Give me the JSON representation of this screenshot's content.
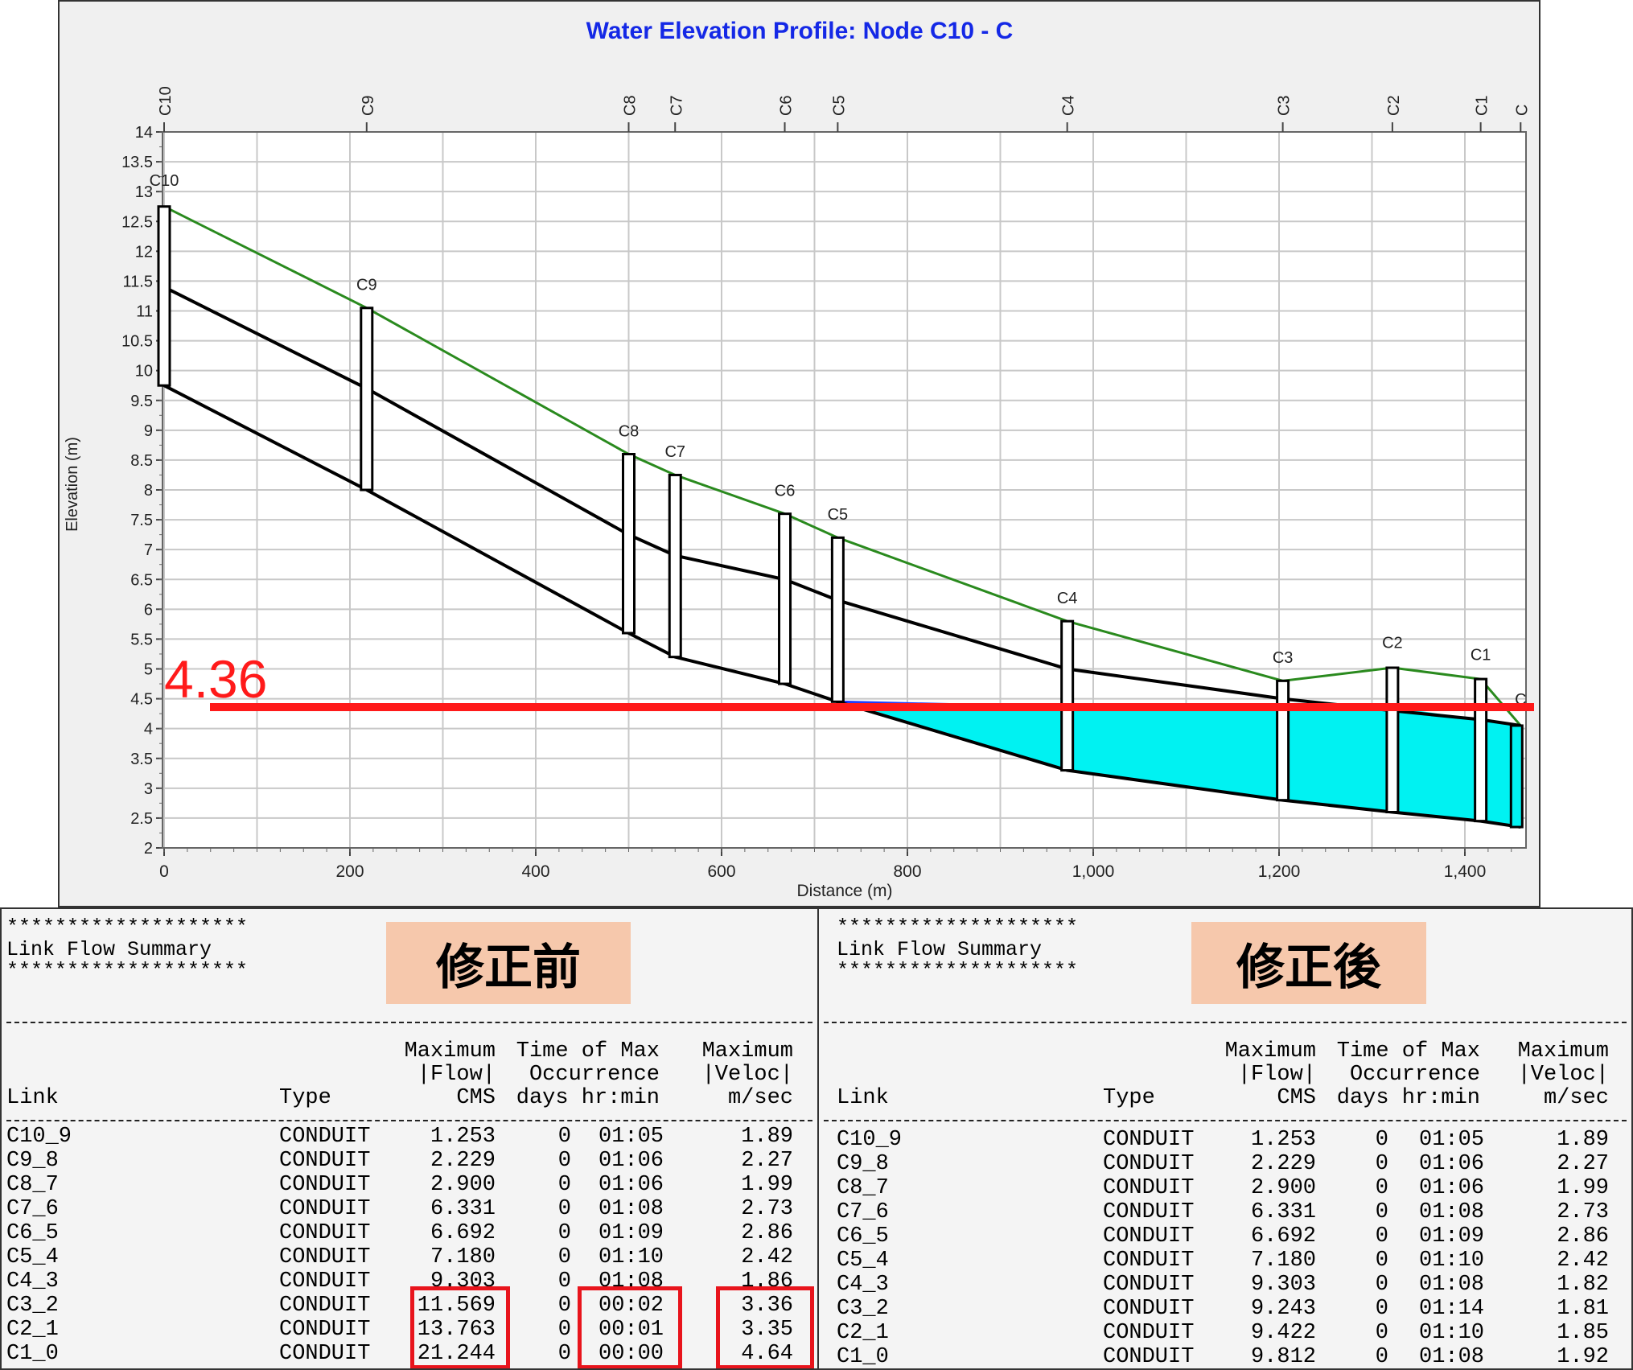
{
  "chart_data": {
    "type": "line",
    "title": "Water Elevation Profile: Node C10 - C",
    "xlabel": "Distance (m)",
    "ylabel": "Elevation (m)",
    "xlim": [
      0,
      1460
    ],
    "ylim": [
      2,
      14
    ],
    "grid": true,
    "x_ticks": [
      0,
      200,
      400,
      600,
      800,
      1000,
      1200,
      1400
    ],
    "x_tick_labels": [
      "0",
      "200",
      "400",
      "600",
      "800",
      "1,000",
      "1,200",
      "1,400"
    ],
    "y_ticks": [
      2,
      2.5,
      3,
      3.5,
      4,
      4.5,
      5,
      5.5,
      6,
      6.5,
      7,
      7.5,
      8,
      8.5,
      9,
      9.5,
      10,
      10.5,
      11,
      11.5,
      12,
      12.5,
      13,
      13.5,
      14
    ],
    "y_tick_labels": [
      "2",
      "2.5",
      "3",
      "3.5",
      "4",
      "4.5",
      "5",
      "5.5",
      "6",
      "6.5",
      "7",
      "7.5",
      "8",
      "8.5",
      "9",
      "9.5",
      "10",
      "10.5",
      "11",
      "11.5",
      "12",
      "12.5",
      "13",
      "13.5",
      "14"
    ],
    "nodes": [
      {
        "name": "C10",
        "x": 0,
        "invert": 9.75,
        "crown": 11.4,
        "ground": 12.75,
        "label_y": 13.1
      },
      {
        "name": "C9",
        "x": 218,
        "invert": 8.0,
        "crown": 9.7,
        "ground": 11.05,
        "label_y": 11.35
      },
      {
        "name": "C8",
        "x": 500,
        "invert": 5.6,
        "crown": 7.25,
        "ground": 8.6,
        "label_y": 8.9
      },
      {
        "name": "C7",
        "x": 550,
        "invert": 5.2,
        "crown": 6.9,
        "ground": 8.25,
        "label_y": 8.55
      },
      {
        "name": "C6",
        "x": 668,
        "invert": 4.75,
        "crown": 6.5,
        "ground": 7.6,
        "label_y": 7.9
      },
      {
        "name": "C5",
        "x": 725,
        "invert": 4.45,
        "crown": 6.15,
        "ground": 7.2,
        "label_y": 7.5
      },
      {
        "name": "C4",
        "x": 972,
        "invert": 3.3,
        "crown": 5.0,
        "ground": 5.8,
        "label_y": 6.1
      },
      {
        "name": "C3",
        "x": 1204,
        "invert": 2.8,
        "crown": 4.5,
        "ground": 4.8,
        "label_y": 5.1
      },
      {
        "name": "C2",
        "x": 1322,
        "invert": 2.6,
        "crown": 4.3,
        "ground": 5.02,
        "label_y": 5.35
      },
      {
        "name": "C1",
        "x": 1417,
        "invert": 2.45,
        "crown": 4.15,
        "ground": 4.83,
        "label_y": 5.15
      },
      {
        "name": "C",
        "x": 1460,
        "invert": 2.35,
        "crown": 4.05,
        "ground": 4.05,
        "label_y": 4.4
      }
    ],
    "water_surface": [
      {
        "x": 725,
        "y": 4.45
      },
      {
        "x": 972,
        "y": 4.36
      },
      {
        "x": 1204,
        "y": 4.36
      },
      {
        "x": 1322,
        "y": 4.36
      },
      {
        "x": 1417,
        "y": 4.15
      },
      {
        "x": 1460,
        "y": 4.05
      }
    ],
    "annotation": {
      "label": "4.36",
      "y": 4.36,
      "color": "#ff1a1a"
    },
    "colors": {
      "ground": "#2a8a1e",
      "pipe": "#000000",
      "water": "#00f2f2",
      "title": "#1428e6"
    }
  },
  "reports": [
    {
      "id": "before",
      "stars": "********************",
      "heading": "Link Flow Summary",
      "banner": "修正前",
      "headers": {
        "link": "Link",
        "type": "Type",
        "flow": [
          "Maximum",
          "|Flow|",
          "CMS"
        ],
        "time": [
          "Time of Max",
          "Occurrence",
          "days hr:min"
        ],
        "veloc": [
          "Maximum",
          "|Veloc|",
          "m/sec"
        ]
      },
      "rows": [
        {
          "link": "C10_9",
          "type": "CONDUIT",
          "flow": "1.253",
          "days": "0",
          "time": "01:05",
          "veloc": "1.89"
        },
        {
          "link": "C9_8",
          "type": "CONDUIT",
          "flow": "2.229",
          "days": "0",
          "time": "01:06",
          "veloc": "2.27"
        },
        {
          "link": "C8_7",
          "type": "CONDUIT",
          "flow": "2.900",
          "days": "0",
          "time": "01:06",
          "veloc": "1.99"
        },
        {
          "link": "C7_6",
          "type": "CONDUIT",
          "flow": "6.331",
          "days": "0",
          "time": "01:08",
          "veloc": "2.73"
        },
        {
          "link": "C6_5",
          "type": "CONDUIT",
          "flow": "6.692",
          "days": "0",
          "time": "01:09",
          "veloc": "2.86"
        },
        {
          "link": "C5_4",
          "type": "CONDUIT",
          "flow": "7.180",
          "days": "0",
          "time": "01:10",
          "veloc": "2.42"
        },
        {
          "link": "C4_3",
          "type": "CONDUIT",
          "flow": "9.303",
          "days": "0",
          "time": "01:08",
          "veloc": "1.86"
        },
        {
          "link": "C3_2",
          "type": "CONDUIT",
          "flow": "11.569",
          "days": "0",
          "time": "00:02",
          "veloc": "3.36"
        },
        {
          "link": "C2_1",
          "type": "CONDUIT",
          "flow": "13.763",
          "days": "0",
          "time": "00:01",
          "veloc": "3.35"
        },
        {
          "link": "C1_0",
          "type": "CONDUIT",
          "flow": "21.244",
          "days": "0",
          "time": "00:00",
          "veloc": "4.64"
        }
      ]
    },
    {
      "id": "after",
      "stars": "********************",
      "heading": "Link Flow Summary",
      "banner": "修正後",
      "headers": {
        "link": "Link",
        "type": "Type",
        "flow": [
          "Maximum",
          "|Flow|",
          "CMS"
        ],
        "time": [
          "Time of Max",
          "Occurrence",
          "days hr:min"
        ],
        "veloc": [
          "Maximum",
          "|Veloc|",
          "m/sec"
        ]
      },
      "rows": [
        {
          "link": "C10_9",
          "type": "CONDUIT",
          "flow": "1.253",
          "days": "0",
          "time": "01:05",
          "veloc": "1.89"
        },
        {
          "link": "C9_8",
          "type": "CONDUIT",
          "flow": "2.229",
          "days": "0",
          "time": "01:06",
          "veloc": "2.27"
        },
        {
          "link": "C8_7",
          "type": "CONDUIT",
          "flow": "2.900",
          "days": "0",
          "time": "01:06",
          "veloc": "1.99"
        },
        {
          "link": "C7_6",
          "type": "CONDUIT",
          "flow": "6.331",
          "days": "0",
          "time": "01:08",
          "veloc": "2.73"
        },
        {
          "link": "C6_5",
          "type": "CONDUIT",
          "flow": "6.692",
          "days": "0",
          "time": "01:09",
          "veloc": "2.86"
        },
        {
          "link": "C5_4",
          "type": "CONDUIT",
          "flow": "7.180",
          "days": "0",
          "time": "01:10",
          "veloc": "2.42"
        },
        {
          "link": "C4_3",
          "type": "CONDUIT",
          "flow": "9.303",
          "days": "0",
          "time": "01:08",
          "veloc": "1.82"
        },
        {
          "link": "C3_2",
          "type": "CONDUIT",
          "flow": "9.243",
          "days": "0",
          "time": "01:14",
          "veloc": "1.81"
        },
        {
          "link": "C2_1",
          "type": "CONDUIT",
          "flow": "9.422",
          "days": "0",
          "time": "01:10",
          "veloc": "1.85"
        },
        {
          "link": "C1_0",
          "type": "CONDUIT",
          "flow": "9.812",
          "days": "0",
          "time": "01:08",
          "veloc": "1.92"
        }
      ]
    }
  ]
}
